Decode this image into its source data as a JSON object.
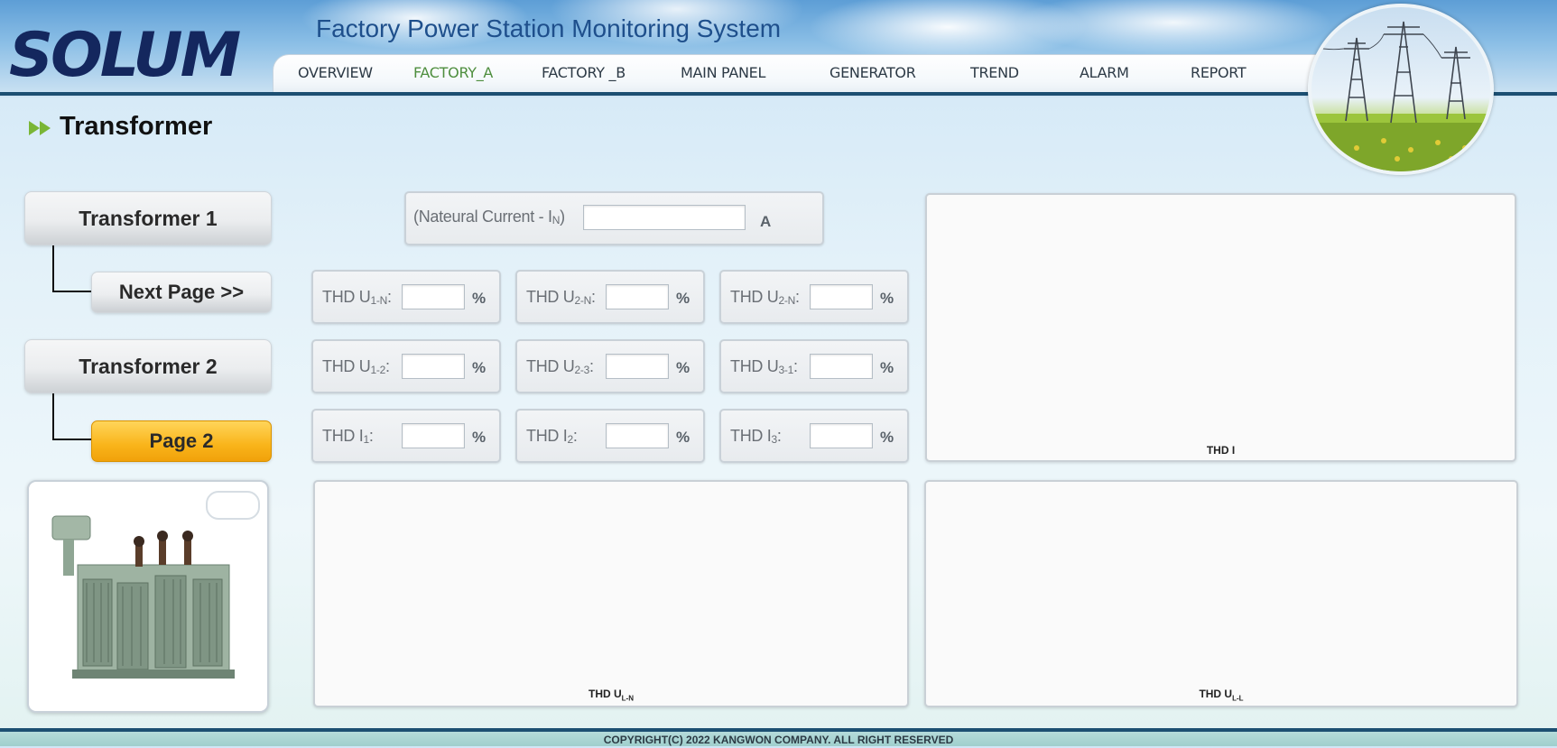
{
  "app": {
    "logo_text": "SOLUM",
    "title": "Factory Power Station Monitoring System"
  },
  "nav": {
    "items": [
      {
        "label": "OVERVIEW",
        "active": false
      },
      {
        "label": "FACTORY_A",
        "active": true
      },
      {
        "label": "FACTORY _B",
        "active": false
      },
      {
        "label": "MAIN PANEL",
        "active": false
      },
      {
        "label": "GENERATOR",
        "active": false
      },
      {
        "label": "TREND",
        "active": false
      },
      {
        "label": "ALARM",
        "active": false
      },
      {
        "label": "REPORT",
        "active": false
      }
    ]
  },
  "page": {
    "title": "Transformer"
  },
  "sidebar": {
    "transformer1_label": "Transformer 1",
    "next_page_label": "Next Page >>",
    "transformer2_label": "Transformer 2",
    "page2_label": "Page 2"
  },
  "current": {
    "label_main": "(Nateural Current - I",
    "label_sub": "N",
    "label_close": ")",
    "value": "",
    "unit": "A"
  },
  "thd_fields": [
    {
      "prefix": "THD U",
      "sub": "1-N",
      "suffix": ":",
      "value": "",
      "unit": "%"
    },
    {
      "prefix": "THD U",
      "sub": "2-N",
      "suffix": ":",
      "value": "",
      "unit": "%"
    },
    {
      "prefix": "THD U",
      "sub": "2-N",
      "suffix": ":",
      "value": "",
      "unit": "%"
    },
    {
      "prefix": "THD U",
      "sub": "1-2",
      "suffix": ":",
      "value": "",
      "unit": "%"
    },
    {
      "prefix": "THD U",
      "sub": "2-3",
      "suffix": ":",
      "value": "",
      "unit": "%"
    },
    {
      "prefix": "THD U",
      "sub": "3-1",
      "suffix": ":",
      "value": "",
      "unit": "%"
    },
    {
      "prefix": "THD I",
      "sub": "1",
      "suffix": ":",
      "value": "",
      "unit": "%"
    },
    {
      "prefix": "THD I",
      "sub": "2",
      "suffix": ":",
      "value": "",
      "unit": "%"
    },
    {
      "prefix": "THD I",
      "sub": "3",
      "suffix": ":",
      "value": "",
      "unit": "%"
    }
  ],
  "charts": {
    "thd_i": {
      "title": "THD I"
    },
    "thd_uln": {
      "title_main": "THD U",
      "title_sub": "L-N"
    },
    "thd_ull": {
      "title_main": "THD U",
      "title_sub": "L-L"
    }
  },
  "colors": {
    "nav_active": "#4e8e3e",
    "nav_line": "#1c4f72",
    "selected_button": "#f9b41a",
    "title_blue": "#1e4f8c"
  },
  "footer": {
    "copyright": "COPYRIGHT(C) 2022 KANGWON COMPANY. ALL RIGHT RESERVED"
  }
}
